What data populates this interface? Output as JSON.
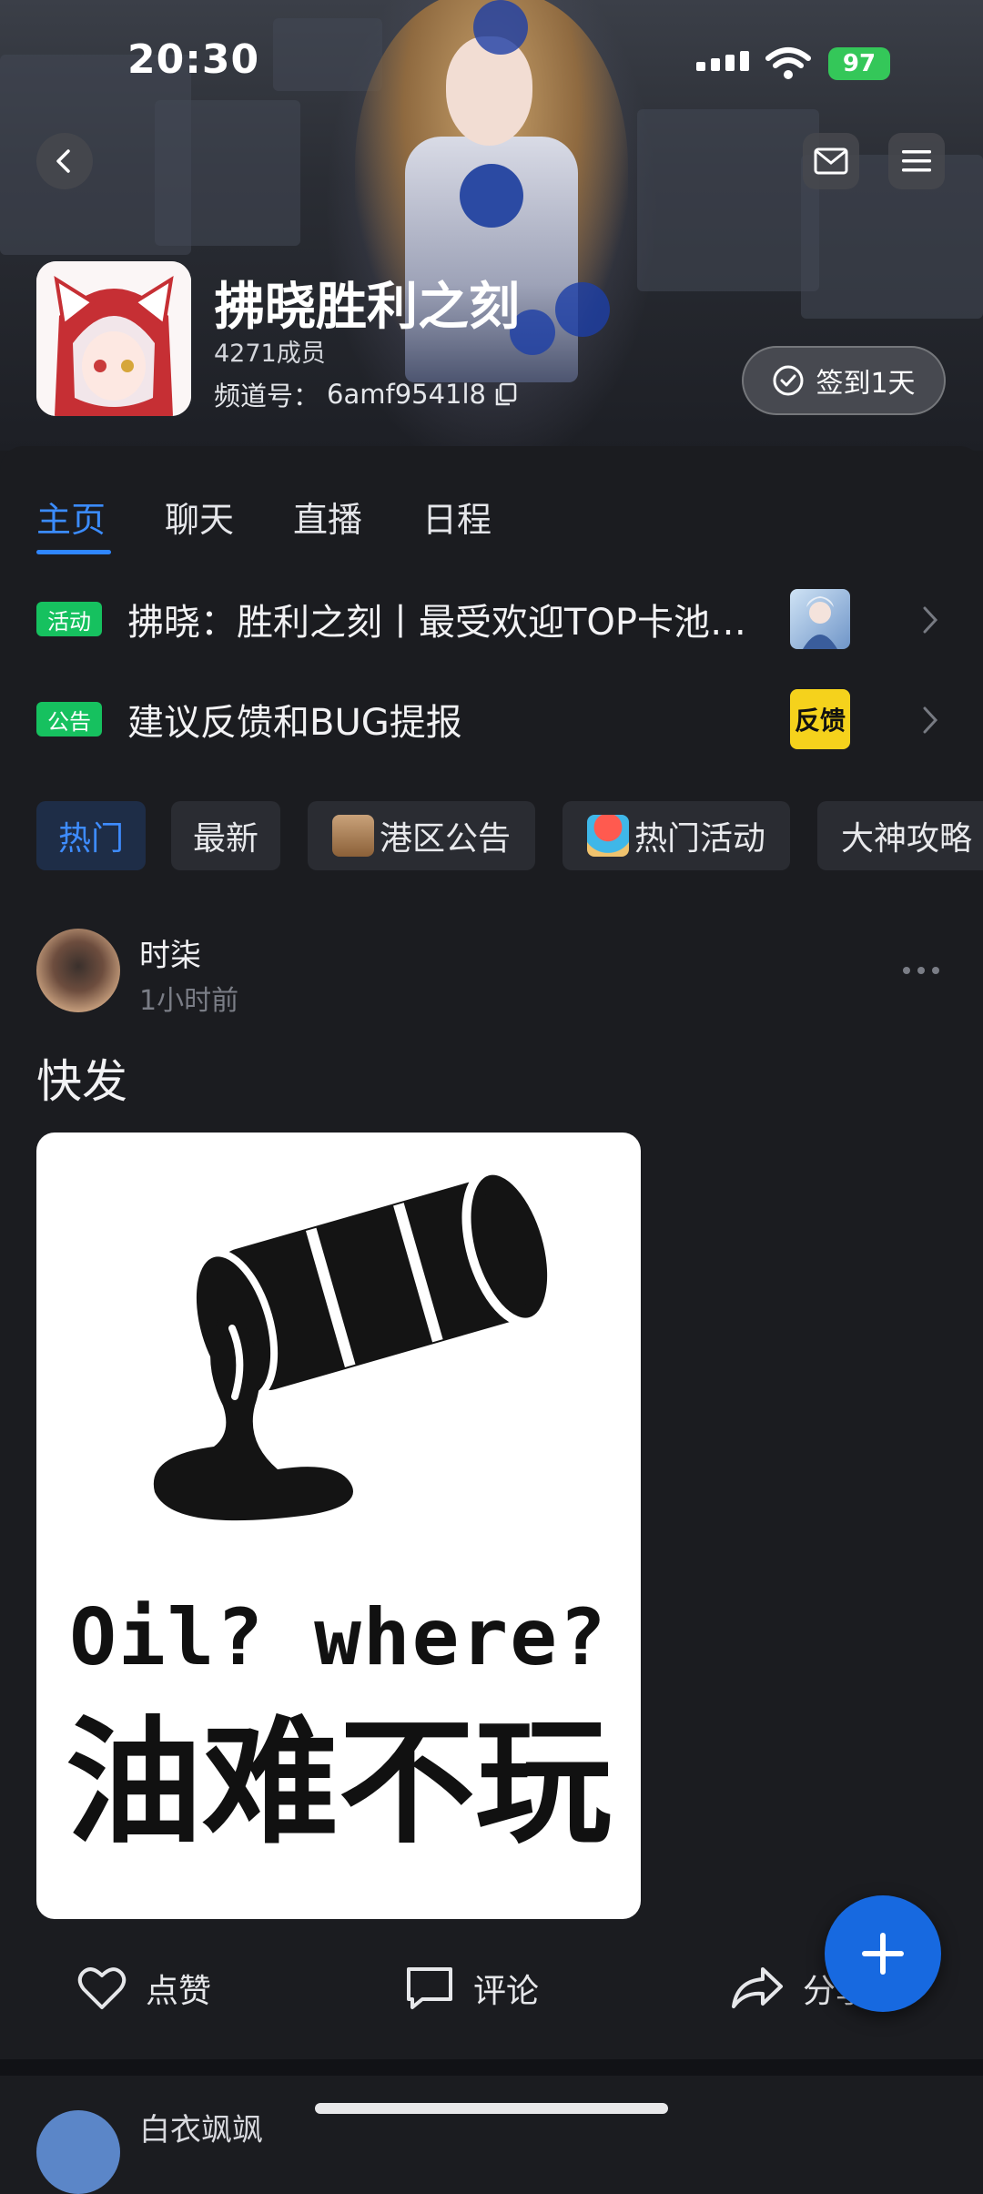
{
  "status_bar": {
    "time": "20:30",
    "battery": "97"
  },
  "channel": {
    "name": "拂晓胜利之刻",
    "members": "4271成员",
    "id_label": "频道号：",
    "id_value": "6amf9541l8",
    "checkin_label": "签到1天"
  },
  "tabs": [
    {
      "label": "主页",
      "active": true
    },
    {
      "label": "聊天",
      "active": false
    },
    {
      "label": "直播",
      "active": false
    },
    {
      "label": "日程",
      "active": false
    }
  ],
  "notices": [
    {
      "tag": "活动",
      "text": "拂晓：胜利之刻丨最受欢迎TOP卡池投票"
    },
    {
      "tag": "公告",
      "text": "建议反馈和BUG提报",
      "thumb_text": "反馈"
    }
  ],
  "filter_chips": [
    {
      "label": "热门",
      "active": true
    },
    {
      "label": "最新",
      "active": false
    },
    {
      "label": "港区公告",
      "active": false,
      "icon": "scroll-icon"
    },
    {
      "label": "热门活动",
      "active": false,
      "icon": "beach-icon"
    },
    {
      "label": "大神攻略",
      "active": false,
      "icon": "volcano-icon"
    }
  ],
  "post": {
    "author": "时柒",
    "time": "1小时前",
    "text": "快发",
    "image_caption_en": "Oil?  where?",
    "image_caption_cn": "油难不玩",
    "actions": {
      "like": "点赞",
      "comment": "评论",
      "share": "分享"
    }
  },
  "next_post": {
    "author": "白衣飒飒"
  },
  "colors": {
    "accent": "#2f86ff",
    "tag_green": "#16c15f",
    "fab": "#1769e0",
    "background": "#1b1c20"
  }
}
